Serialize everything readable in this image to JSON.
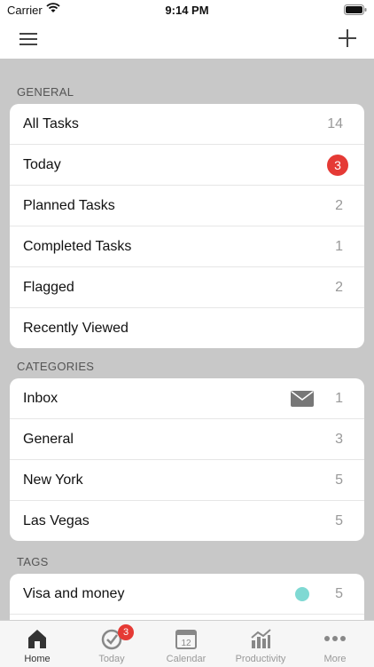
{
  "status": {
    "carrier": "Carrier",
    "time": "9:14 PM"
  },
  "general": {
    "header": "GENERAL",
    "items": [
      {
        "label": "All Tasks",
        "count": "14"
      },
      {
        "label": "Today",
        "badge": "3"
      },
      {
        "label": "Planned Tasks",
        "count": "2"
      },
      {
        "label": "Completed Tasks",
        "count": "1"
      },
      {
        "label": "Flagged",
        "count": "2"
      },
      {
        "label": "Recently Viewed"
      }
    ]
  },
  "categories": {
    "header": "CATEGORIES",
    "items": [
      {
        "label": "Inbox",
        "count": "1",
        "icon": "mail-icon"
      },
      {
        "label": "General",
        "count": "3"
      },
      {
        "label": "New York",
        "count": "5"
      },
      {
        "label": "Las Vegas",
        "count": "5"
      }
    ]
  },
  "tags": {
    "header": "TAGS",
    "items": [
      {
        "label": "Visa and money",
        "count": "5",
        "dot_color": "#7fd9d3"
      }
    ]
  },
  "tab_bar": {
    "tabs": [
      {
        "label": "Home",
        "icon": "home-icon"
      },
      {
        "label": "Today",
        "icon": "today-check-icon",
        "badge": "3"
      },
      {
        "label": "Calendar",
        "icon": "calendar-icon",
        "day": "12"
      },
      {
        "label": "Productivity",
        "icon": "productivity-icon"
      },
      {
        "label": "More",
        "icon": "more-icon"
      }
    ]
  },
  "colors": {
    "accent": "#e53a35",
    "tag_dot": "#7fd9d3",
    "background": "#c8c8c8"
  }
}
